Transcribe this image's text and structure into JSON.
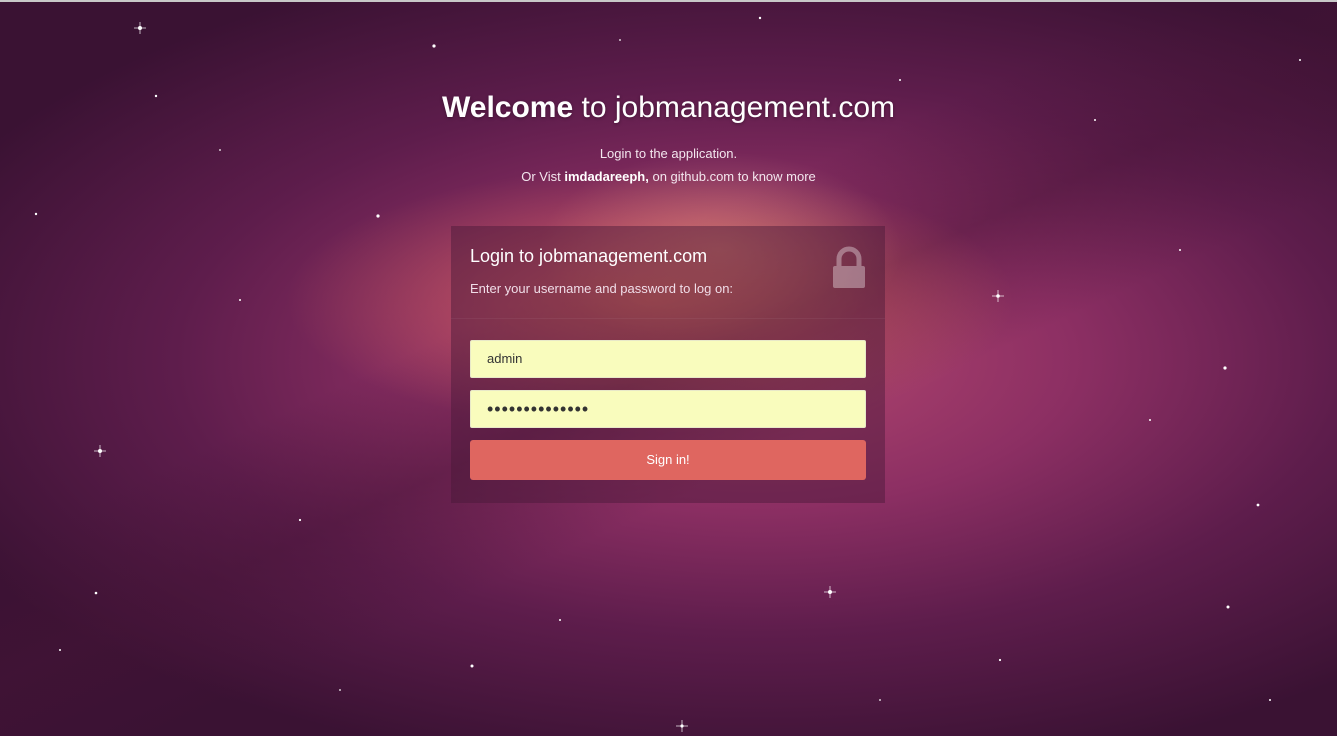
{
  "hero": {
    "title_strong": "Welcome",
    "title_rest": " to jobmanagement.com",
    "line1": "Login to the application.",
    "line2_pre": "Or Vist ",
    "line2_user": "imdadareeph,",
    "line2_post": " on github.com to know more"
  },
  "login": {
    "title": "Login to jobmanagement.com",
    "description": "Enter your username and password to log on:",
    "username_value": "admin",
    "password_masked": "••••••••••••••",
    "signin_label": "Sign in!"
  },
  "icons": {
    "lock": "lock-icon"
  },
  "colors": {
    "field_background": "#f9fcbd",
    "signin_button": "#df6660"
  }
}
